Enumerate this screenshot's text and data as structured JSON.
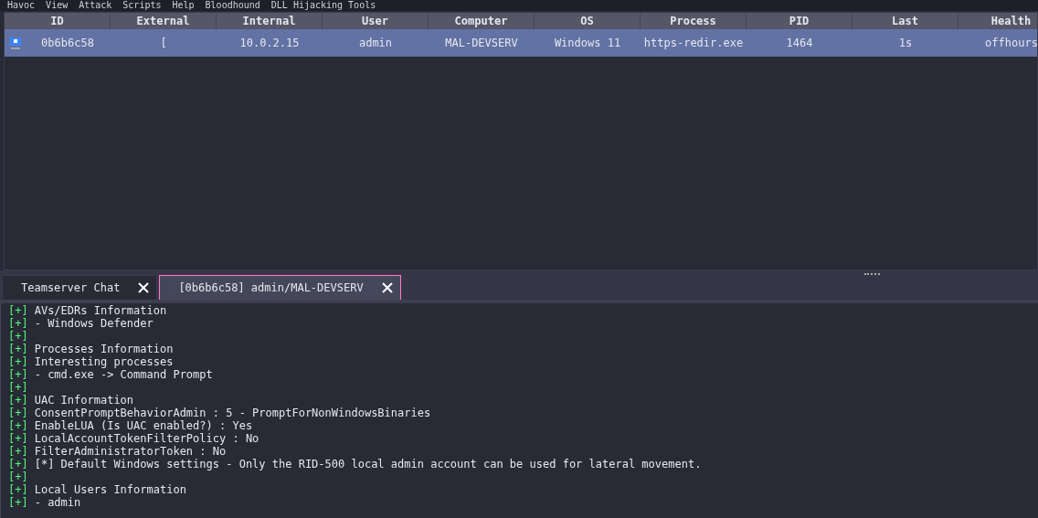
{
  "menu": [
    "Havoc",
    "View",
    "Attack",
    "Scripts",
    "Help",
    "Bloodhound",
    "DLL Hijacking Tools"
  ],
  "table": {
    "columns": [
      "ID",
      "External",
      "Internal",
      "User",
      "Computer",
      "OS",
      "Process",
      "PID",
      "Last",
      "Health"
    ],
    "rows": [
      {
        "selected": true,
        "cells": [
          "0b6b6c58",
          "[",
          "10.0.2.15",
          "admin",
          "MAL-DEVSERV",
          "Windows 11",
          "https-redir.exe",
          "1464",
          "1s",
          "offhours"
        ]
      }
    ]
  },
  "tabs": [
    {
      "label": "Teamserver Chat",
      "selected": false
    },
    {
      "label": "[0b6b6c58] admin/MAL-DEVSERV",
      "selected": true
    }
  ],
  "console": [
    {
      "prefix": "[+]",
      "text": "AVs/EDRs Information"
    },
    {
      "prefix": "[+]",
      "text": "- Windows Defender"
    },
    {
      "prefix": "[+]"
    },
    {
      "prefix": "[+]",
      "text": "Processes Information"
    },
    {
      "prefix": "[+]",
      "text": "Interesting processes"
    },
    {
      "prefix": "[+]",
      "text": "- cmd.exe -> Command Prompt"
    },
    {
      "prefix": "[+]"
    },
    {
      "prefix": "[+]",
      "text": "UAC Information"
    },
    {
      "prefix": "[+]",
      "text": "ConsentPromptBehaviorAdmin : 5 - PromptForNonWindowsBinaries"
    },
    {
      "prefix": "[+]",
      "text": "EnableLUA (Is UAC enabled?) : Yes"
    },
    {
      "prefix": "[+]",
      "text": "LocalAccountTokenFilterPolicy : No"
    },
    {
      "prefix": "[+]",
      "text": "FilterAdministratorToken : No"
    },
    {
      "prefix": "[+]",
      "text": "[*] Default Windows settings - Only the RID-500 local admin account can be used for lateral movement."
    },
    {
      "prefix": "[+]"
    },
    {
      "prefix": "[+]",
      "text": "Local Users Information"
    },
    {
      "prefix": "[+]",
      "text": "- admin"
    }
  ]
}
